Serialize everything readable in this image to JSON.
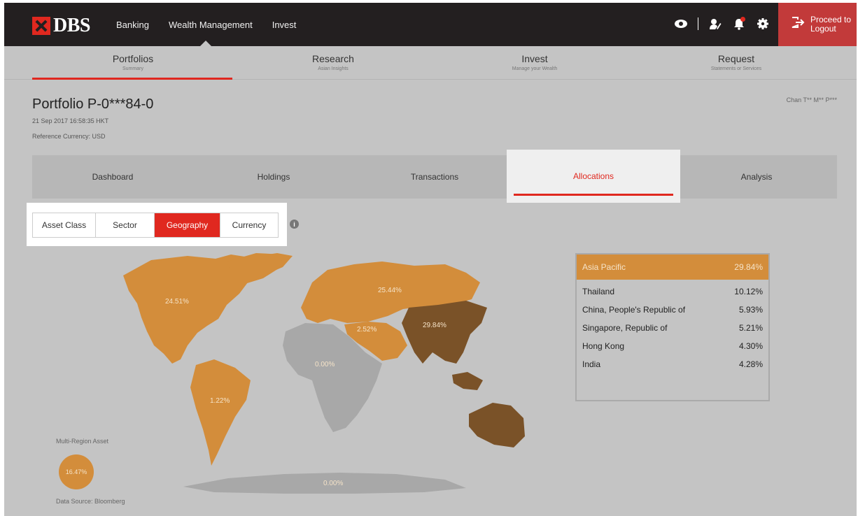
{
  "brand": {
    "name": "DBS"
  },
  "topnav": {
    "items": [
      "Banking",
      "Wealth Management",
      "Invest"
    ]
  },
  "header_icons": [
    "eye-icon",
    "profile-edit-icon",
    "bell-icon",
    "gear-icon"
  ],
  "logout": {
    "label": "Proceed to Logout"
  },
  "main_tabs": [
    {
      "title": "Portfolios",
      "sub": "Summary"
    },
    {
      "title": "Research",
      "sub": "Asian Insights"
    },
    {
      "title": "Invest",
      "sub": "Manage your Wealth"
    },
    {
      "title": "Request",
      "sub": "Statements or Services"
    }
  ],
  "portfolio": {
    "title": "Portfolio P-0***84-0",
    "date": "21 Sep 2017 16:58:35 HKT",
    "currency": "Reference Currency: USD",
    "user": "Chan T** M** P***"
  },
  "sub_tabs": [
    "Dashboard",
    "Holdings",
    "Transactions",
    "Allocations",
    "Analysis"
  ],
  "active_sub_tab": "Allocations",
  "filters": [
    "Asset Class",
    "Sector",
    "Geography",
    "Currency"
  ],
  "active_filter": "Geography",
  "map_regions": {
    "north_america": "24.51%",
    "europe": "25.44%",
    "middle_east": "2.52%",
    "asia_pacific": "29.84%",
    "africa": "0.00%",
    "south_america": "1.22%",
    "antarctica": "0.00%"
  },
  "multi_region": {
    "label": "Multi-Region Asset",
    "value": "16.47%"
  },
  "data_source": "Data Source: Bloomberg",
  "region_detail": {
    "name": "Asia Pacific",
    "total": "29.84%",
    "rows": [
      {
        "country": "Thailand",
        "pct": "10.12%"
      },
      {
        "country": "China, People's Republic of",
        "pct": "5.93%"
      },
      {
        "country": "Singapore, Republic of",
        "pct": "5.21%"
      },
      {
        "country": "Hong Kong",
        "pct": "4.30%"
      },
      {
        "country": "India",
        "pct": "4.28%"
      }
    ]
  },
  "colors": {
    "brand_red": "#e0281f",
    "region_orange": "#d38d3b",
    "region_dark": "#7a5228",
    "region_grey": "#a8a8a8"
  }
}
